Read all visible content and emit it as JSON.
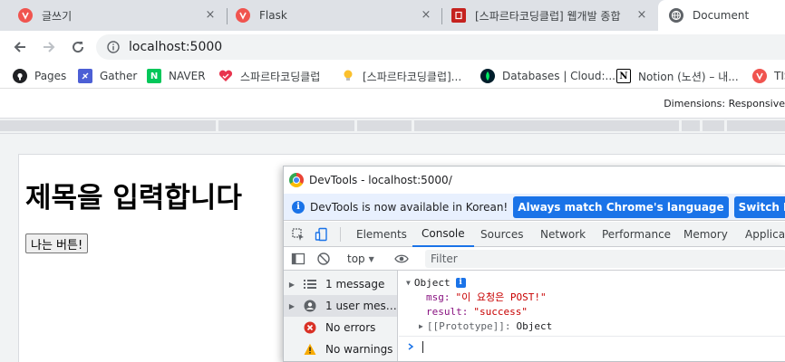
{
  "browser": {
    "tabs": [
      {
        "label": "글쓰기",
        "icon": "velog-icon"
      },
      {
        "label": "Flask",
        "icon": "velog-icon"
      },
      {
        "label": "[스파르타코딩클럽] 웹개발 종합",
        "icon": "notebook-icon"
      },
      {
        "label": "Document",
        "icon": "globe-icon"
      }
    ],
    "close_symbol": "×",
    "url": "localhost:5000",
    "bookmarks": [
      {
        "label": "Pages",
        "icon": "github-icon"
      },
      {
        "label": "Gather",
        "icon": "gather-icon"
      },
      {
        "label": "NAVER",
        "icon": "naver-icon",
        "glyph": "N"
      },
      {
        "label": "스파르타코딩클럽",
        "icon": "sparta-icon"
      },
      {
        "label": "[스파르타코딩클럽]...",
        "icon": "lightbulb-icon"
      },
      {
        "label": "Databases | Cloud:...",
        "icon": "mongodb-icon"
      },
      {
        "label": "Notion (노션) – 내...",
        "icon": "notion-icon",
        "glyph": "N"
      },
      {
        "label": "TIS",
        "icon": "velog-icon"
      }
    ],
    "device_toolbar": {
      "dimensions_label": "Dimensions: Responsive"
    },
    "colors": {
      "tabstrip": "#dee1e6",
      "accent": "#1a73e8"
    }
  },
  "page": {
    "heading": "제목을 입력합니다",
    "button_label": "나는 버튼!"
  },
  "devtools": {
    "title": "DevTools - localhost:5000/",
    "infobar": {
      "message": "DevTools is now available in Korean!",
      "match_button": "Always match Chrome's language",
      "switch_button": "Switch DevTools to Kore"
    },
    "panel_tabs": [
      "Elements",
      "Console",
      "Sources",
      "Network",
      "Performance",
      "Memory",
      "Applicat"
    ],
    "active_tab": "Console",
    "console_toolbar": {
      "context": "top",
      "filter_placeholder": "Filter"
    },
    "sidebar": [
      {
        "label": "1 message",
        "icon": "list-icon"
      },
      {
        "label": "1 user mess...",
        "icon": "user-icon"
      },
      {
        "label": "No errors",
        "icon": "error-icon"
      },
      {
        "label": "No warnings",
        "icon": "warning-icon"
      }
    ],
    "output": {
      "object_label": "Object",
      "info_badge": "i",
      "msg_key": "msg:",
      "msg_value": "\"이 요청은 POST!\"",
      "result_key": "result:",
      "result_value": "\"success\"",
      "prototype_key": "[[Prototype]]:",
      "prototype_value": "Object"
    }
  }
}
